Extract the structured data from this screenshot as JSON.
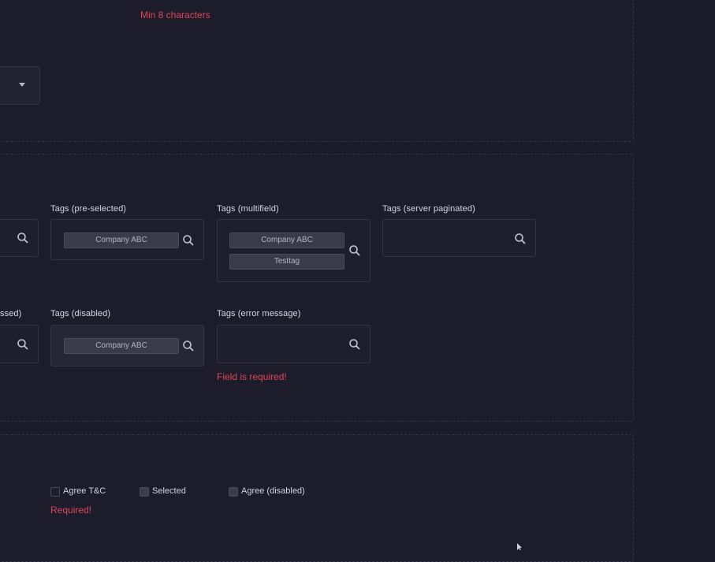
{
  "section_password": {
    "error": "Min 8 characters"
  },
  "section_tags": {
    "row1": {
      "preselected": {
        "label": "Tags (pre-selected)",
        "chips": [
          "Company ABC"
        ]
      },
      "multifield": {
        "label": "Tags (multifield)",
        "chips": [
          "Company ABC",
          "Testtag"
        ]
      },
      "server": {
        "label": "Tags (server paginated)",
        "chips": []
      }
    },
    "row2": {
      "partial_label": "ssed)",
      "disabled": {
        "label": "Tags (disabled)",
        "chips": [
          "Company ABC"
        ]
      },
      "error": {
        "label": "Tags (error message)",
        "message": "Field is required!"
      }
    }
  },
  "section_checkboxes": {
    "items": [
      {
        "label": "Agree T&C",
        "checked": false
      },
      {
        "label": "Selected",
        "checked": true
      },
      {
        "label": "Agree (disabled)",
        "checked": true
      }
    ],
    "error": "Required!"
  },
  "icons": {
    "search": "search-icon",
    "caret": "chevron-down-icon"
  },
  "colors": {
    "background": "#1b1b29",
    "error": "#e0455a",
    "border": "#34344a"
  }
}
